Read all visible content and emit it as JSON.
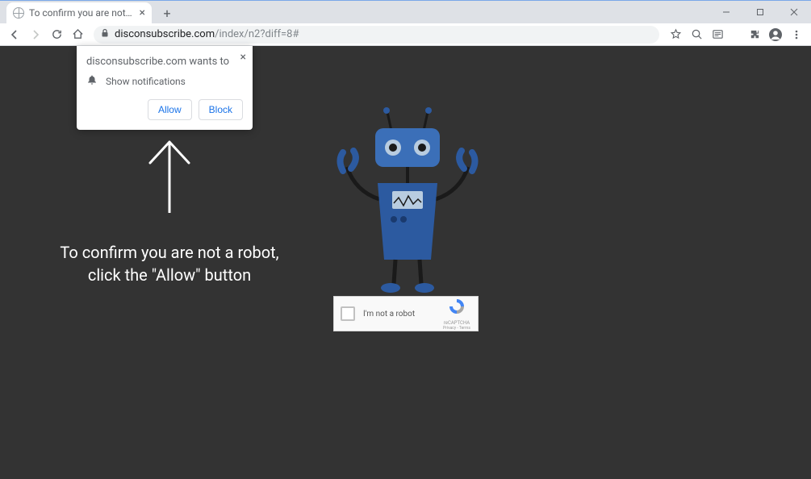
{
  "tab": {
    "title": "To confirm you are not a robot, c"
  },
  "url": {
    "domain": "disconsubscribe.com",
    "path": "/index/n2?diff=8#"
  },
  "permission_popup": {
    "title": "disconsubscribe.com wants to",
    "row_label": "Show notifications",
    "allow_label": "Allow",
    "block_label": "Block"
  },
  "page": {
    "message_line1": "To confirm you are not a robot,",
    "message_line2": "click the \"Allow\" button"
  },
  "captcha": {
    "label": "I'm not a robot",
    "brand": "reCAPTCHA",
    "privacy": "Privacy - Terms"
  }
}
